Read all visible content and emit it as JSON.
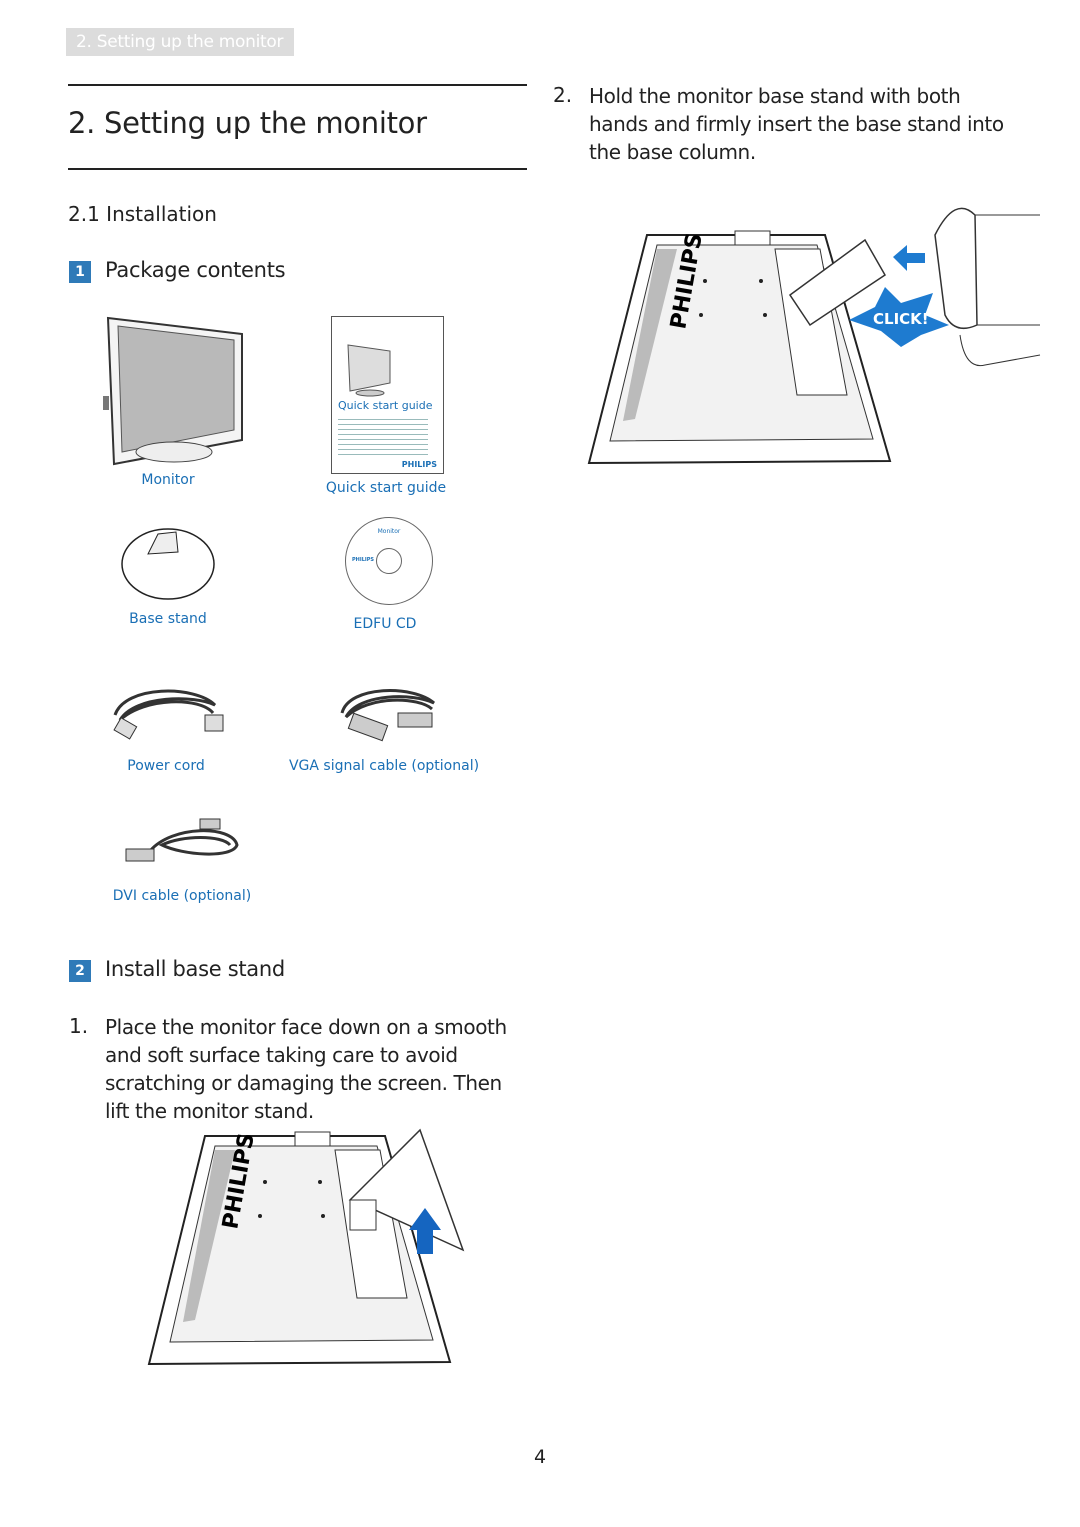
{
  "header_tab": "2. Setting up the monitor",
  "title": "2.  Setting up the monitor",
  "section": "2.1 Installation",
  "steps": [
    {
      "badge": "1",
      "label": "Package contents"
    },
    {
      "badge": "2",
      "label": "Install base stand"
    }
  ],
  "package_items": [
    {
      "label": "Monitor"
    },
    {
      "label": "Quick start guide"
    },
    {
      "label": "Base stand"
    },
    {
      "label": "EDFU CD"
    },
    {
      "label": "Power cord"
    },
    {
      "label": "VGA signal cable (optional)"
    },
    {
      "label": "DVI cable (optional)"
    }
  ],
  "guide_cover": {
    "title": "Quick start guide",
    "brand": "PHILIPS"
  },
  "cd_label": {
    "title": "Monitor",
    "brand": "PHILIPS"
  },
  "instructions": [
    {
      "num": "1.",
      "text": "Place the monitor face down on a smooth and soft surface taking care to avoid scratching or damaging the screen. Then lift the monitor stand."
    },
    {
      "num": "2.",
      "text": "Hold the monitor base stand with both hands and firmly insert the base stand into the base column."
    }
  ],
  "illustration": {
    "brand": "PHILIPS",
    "click_label": "CLICK!"
  },
  "page_number": "4",
  "colors": {
    "accent": "#1a6fb5",
    "badge": "#2f7ab8",
    "tab": "#dcdcdc"
  }
}
